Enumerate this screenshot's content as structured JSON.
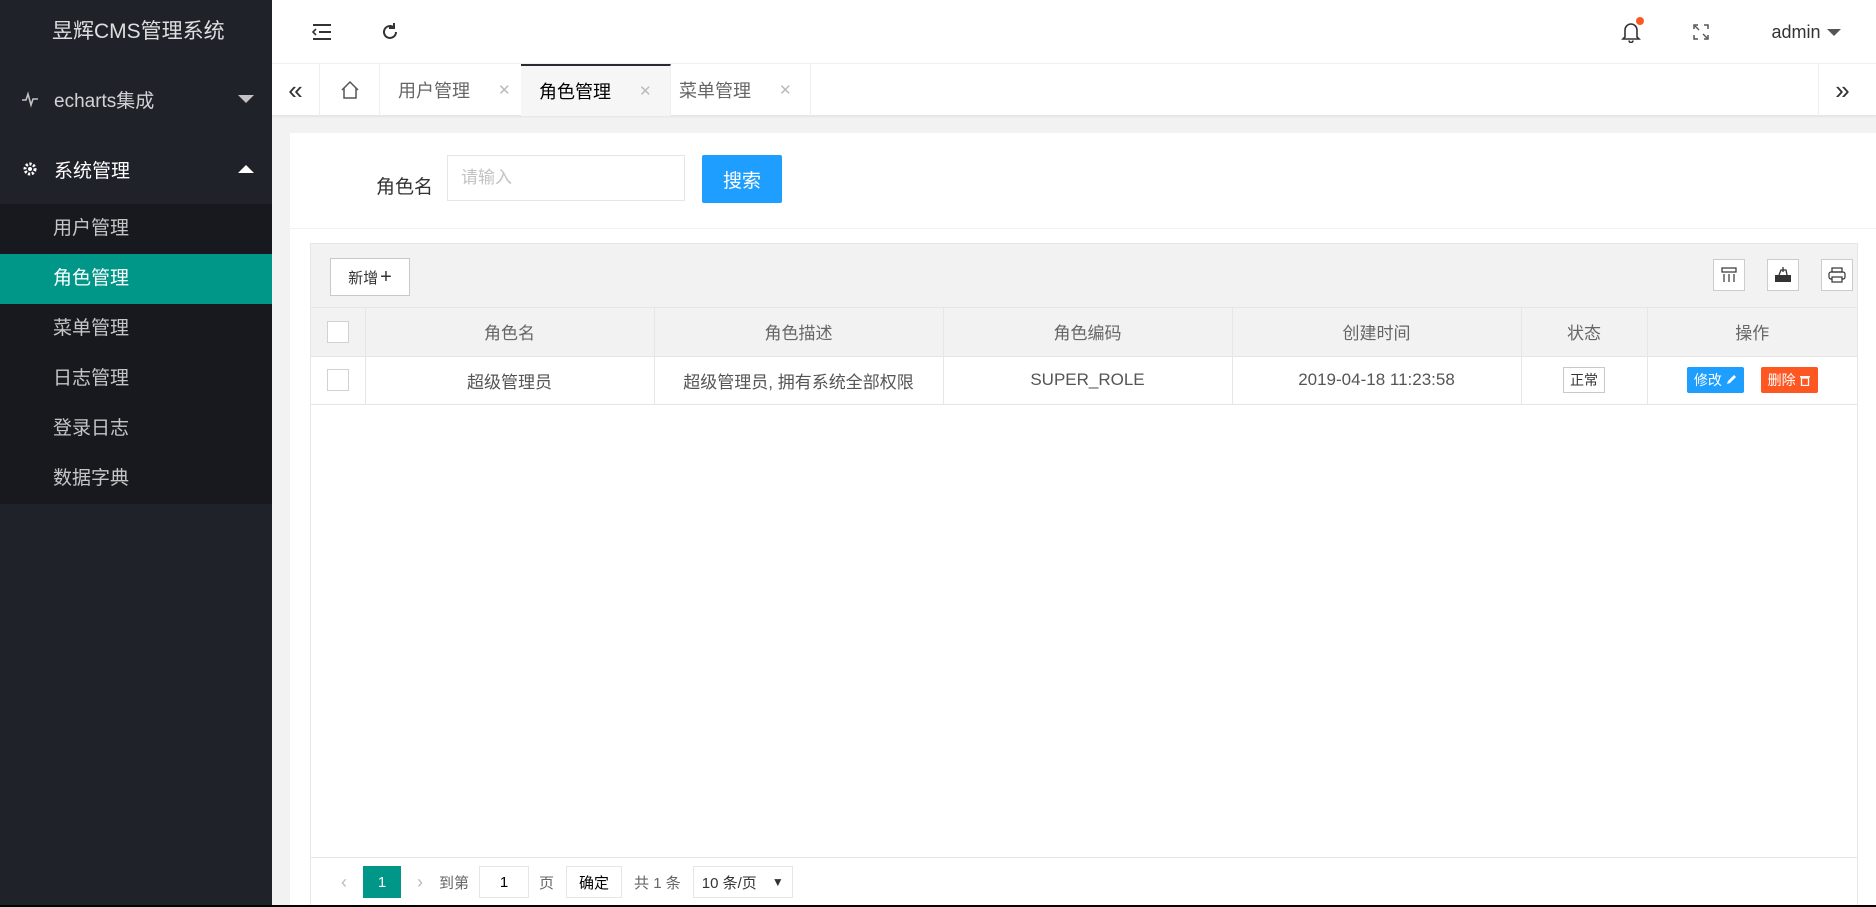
{
  "app": {
    "title": "昱辉CMS管理系统"
  },
  "sidebar": {
    "groups": [
      {
        "label": "echarts集成",
        "icon": "pulse-icon",
        "expanded": false
      },
      {
        "label": "系统管理",
        "icon": "gear-icon",
        "expanded": true,
        "items": [
          {
            "label": "用户管理",
            "active": false
          },
          {
            "label": "角色管理",
            "active": true
          },
          {
            "label": "菜单管理",
            "active": false
          },
          {
            "label": "日志管理",
            "active": false
          },
          {
            "label": "登录日志",
            "active": false
          },
          {
            "label": "数据字典",
            "active": false
          }
        ]
      }
    ]
  },
  "header": {
    "icons": [
      "menu-fold-icon",
      "refresh-icon",
      "bell-icon",
      "fullscreen-icon"
    ],
    "user": "admin"
  },
  "tabs": {
    "items": [
      {
        "label": "用户管理",
        "active": false
      },
      {
        "label": "角色管理",
        "active": true
      },
      {
        "label": "菜单管理",
        "active": false
      }
    ]
  },
  "search": {
    "label": "角色名",
    "placeholder": "请输入",
    "button": "搜索"
  },
  "toolbar": {
    "add_label": "新增",
    "icons": [
      "columns-icon",
      "export-icon",
      "print-icon"
    ]
  },
  "table": {
    "columns": [
      "角色名",
      "角色描述",
      "角色编码",
      "创建时间",
      "状态",
      "操作"
    ],
    "rows": [
      {
        "name": "超级管理员",
        "desc": "超级管理员, 拥有系统全部权限",
        "code": "SUPER_ROLE",
        "created": "2019-04-18 11:23:58",
        "status": "正常",
        "edit": "修改",
        "delete": "删除"
      }
    ]
  },
  "pager": {
    "current": "1",
    "goto_label": "到第",
    "goto_value": "1",
    "page_unit": "页",
    "confirm": "确定",
    "total": "共 1 条",
    "page_size": "10 条/页"
  },
  "colors": {
    "accent": "#009688",
    "primary": "#1e9fff",
    "danger": "#ff5722",
    "sidebar": "#20222a"
  }
}
